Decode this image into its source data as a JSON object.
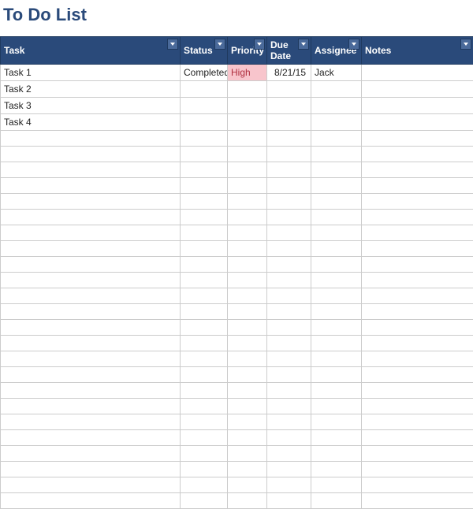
{
  "title": "To Do List",
  "columns": {
    "task": "Task",
    "status": "Status",
    "priority": "Priority",
    "duedate": "Due Date",
    "assignee": "Assignee",
    "notes": "Notes"
  },
  "rows": [
    {
      "task": "Task 1",
      "status": "Completed",
      "priority": "High",
      "priority_flag": "high",
      "duedate": "8/21/15",
      "assignee": "Jack",
      "notes": ""
    },
    {
      "task": "Task 2",
      "status": "",
      "priority": "",
      "priority_flag": "",
      "duedate": "",
      "assignee": "",
      "notes": ""
    },
    {
      "task": "Task 3",
      "status": "",
      "priority": "",
      "priority_flag": "",
      "duedate": "",
      "assignee": "",
      "notes": ""
    },
    {
      "task": "Task 4",
      "status": "",
      "priority": "",
      "priority_flag": "",
      "duedate": "",
      "assignee": "",
      "notes": ""
    }
  ],
  "empty_row_count": 24,
  "colors": {
    "header_bg": "#2a4a7a",
    "priority_high_bg": "#f8c5cc"
  }
}
